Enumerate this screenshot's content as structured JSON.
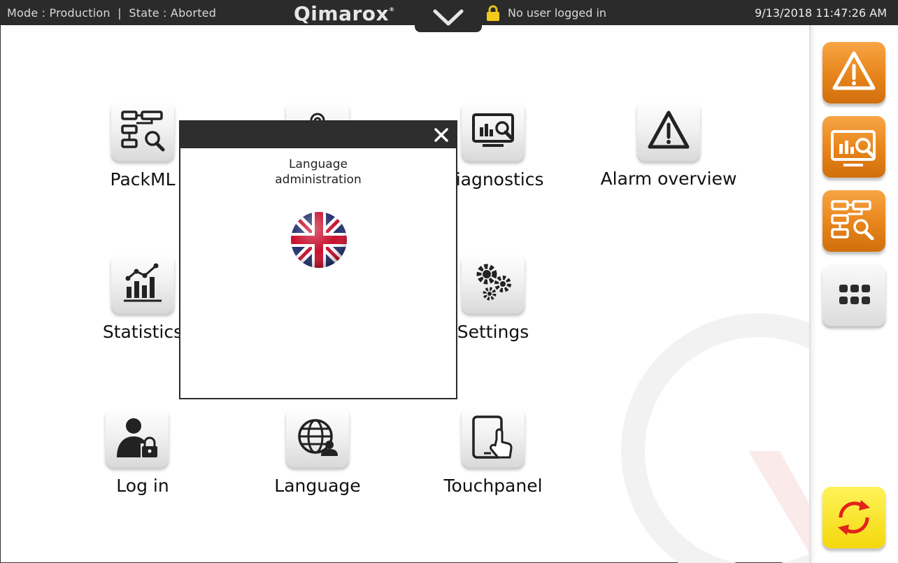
{
  "topbar": {
    "mode_state": "Mode : Production  |  State : Aborted",
    "logo": "Qimarox",
    "logo_mark": "®",
    "user_status": "No user logged in",
    "datetime": "9/13/2018 11:47:26 AM"
  },
  "tiles": {
    "packml": "PackML",
    "diagnostics": "Diagnostics",
    "alarm_overview": "Alarm overview",
    "statistics": "Statistics",
    "settings": "Settings",
    "login": "Log in",
    "language": "Language",
    "touchpanel": "Touchpanel"
  },
  "dialog": {
    "title_line1": "Language",
    "title_line2": "administration",
    "flag_icon": "uk-flag-icon"
  },
  "sidebar": {
    "icons": [
      "warning-icon",
      "diagnostics-monitor-icon",
      "packml-flowchart-icon",
      "more-apps-icon",
      "refresh-cycle-icon"
    ]
  },
  "colors": {
    "topbar_bg": "#2b2b2b",
    "orange": "#e7841a",
    "yellow": "#f3d80c",
    "refresh_red": "#e2231a"
  }
}
